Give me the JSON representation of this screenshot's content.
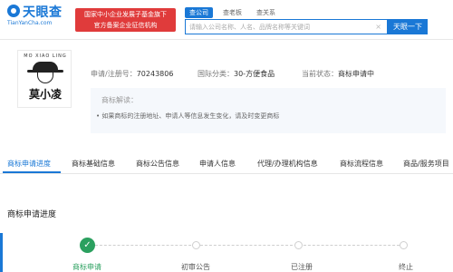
{
  "header": {
    "brand": "天眼查",
    "domain": "TianYanCha.com",
    "badge_line1": "国家中小企业发展子基金旗下",
    "badge_line2": "官方备案企业征信机构",
    "search_tabs": [
      "查公司",
      "查老板",
      "查关系"
    ],
    "search_placeholder": "请输入公司名称、人名、品牌名称等关键词",
    "search_button": "天眼一下",
    "clear_icon": "×"
  },
  "trademark": {
    "logo_arc_text": "MO XIAO LING",
    "logo_name": "莫小凌",
    "reg_number_label": "申请/注册号：",
    "reg_number": "70243806",
    "class_label": "国际分类：",
    "class_value": "30-方便食品",
    "status_label": "当前状态：",
    "status_value": "商标申请中",
    "notice_title": "商标解读：",
    "notice_text": "如果商标的注册地址、申请人等信息发生变化，请及时变更商标"
  },
  "tabs": [
    "商标申请进度",
    "商标基础信息",
    "商标公告信息",
    "申请人信息",
    "代理/办理机构信息",
    "商标流程信息",
    "商品/服务项目"
  ],
  "progress": {
    "title": "商标申请进度",
    "steps": [
      "商标申请",
      "初审公告",
      "已注册",
      "终止"
    ],
    "done_icon": "✓"
  },
  "colors": {
    "accent": "#1a78d6",
    "badge": "#e03b3b",
    "done": "#2ba05f"
  }
}
